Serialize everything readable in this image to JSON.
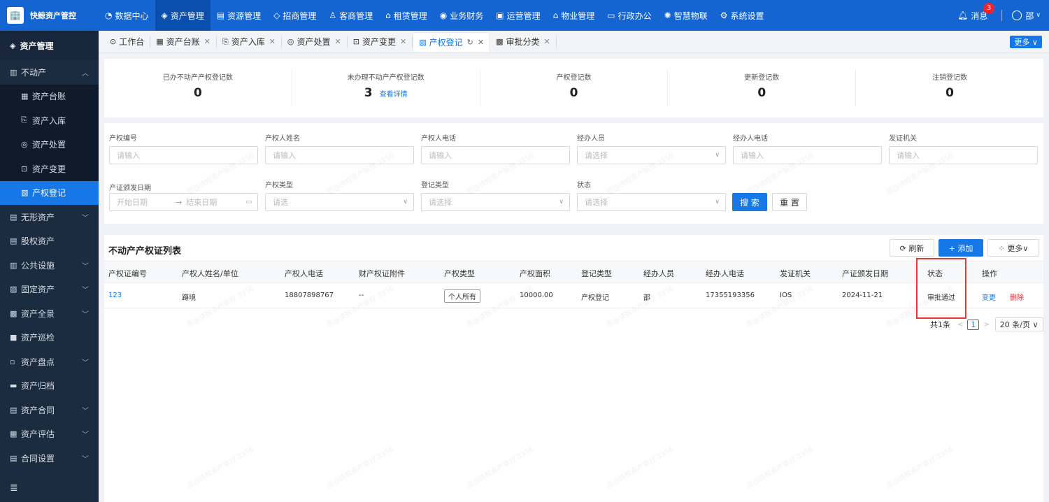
{
  "app": {
    "logo_glyph": "🏢",
    "title": "快鲸资产管控"
  },
  "nav": [
    {
      "icon": "◔",
      "label": "数据中心"
    },
    {
      "icon": "◈",
      "label": "资产管理",
      "active": true
    },
    {
      "icon": "▤",
      "label": "资源管理"
    },
    {
      "icon": "◇",
      "label": "招商管理"
    },
    {
      "icon": "♙",
      "label": "客商管理"
    },
    {
      "icon": "⌂",
      "label": "租赁管理"
    },
    {
      "icon": "◉",
      "label": "业务财务"
    },
    {
      "icon": "▣",
      "label": "运营管理"
    },
    {
      "icon": "⌂",
      "label": "物业管理"
    },
    {
      "icon": "▭",
      "label": "行政办公"
    },
    {
      "icon": "✺",
      "label": "智慧物联"
    },
    {
      "icon": "⚙",
      "label": "系统设置"
    }
  ],
  "header": {
    "messages_label": "消息",
    "badge": "3",
    "user_name": "邵"
  },
  "sidebar": {
    "title": "资产管理",
    "group": "不动产",
    "sub_items": [
      {
        "icon": "▦",
        "label": "资产台账"
      },
      {
        "icon": "⎘",
        "label": "资产入库"
      },
      {
        "icon": "◎",
        "label": "资产处置"
      },
      {
        "icon": "⊡",
        "label": "资产变更"
      },
      {
        "icon": "▧",
        "label": "产权登记",
        "active": true
      }
    ],
    "items": [
      {
        "icon": "▤",
        "label": "无形资产",
        "chev": true
      },
      {
        "icon": "▤",
        "label": "股权资产",
        "chev": false
      },
      {
        "icon": "▥",
        "label": "公共设施",
        "chev": true
      },
      {
        "icon": "▨",
        "label": "固定资产",
        "chev": true
      },
      {
        "icon": "▩",
        "label": "资产全景",
        "chev": true
      },
      {
        "icon": "■",
        "label": "资产巡检",
        "chev": false
      },
      {
        "icon": "▫",
        "label": "资产盘点",
        "chev": true
      },
      {
        "icon": "▬",
        "label": "资产归档",
        "chev": false
      },
      {
        "icon": "▤",
        "label": "资产合同",
        "chev": true
      },
      {
        "icon": "▦",
        "label": "资产评估",
        "chev": true
      },
      {
        "icon": "▤",
        "label": "合同设置",
        "chev": true
      }
    ],
    "collapse_icon": "≣"
  },
  "tabs": [
    {
      "icon": "⊙",
      "label": "工作台",
      "closable": false
    },
    {
      "icon": "▦",
      "label": "资产台账",
      "closable": true
    },
    {
      "icon": "⎘",
      "label": "资产入库",
      "closable": true
    },
    {
      "icon": "◎",
      "label": "资产处置",
      "closable": true
    },
    {
      "icon": "⊡",
      "label": "资产变更",
      "closable": true
    },
    {
      "icon": "▧",
      "label": "产权登记",
      "closable": true,
      "active": true
    },
    {
      "icon": "▩",
      "label": "审批分类",
      "closable": true
    }
  ],
  "tabs_more": "更多 ∨",
  "stats": [
    {
      "label": "已办不动产产权登记数",
      "value": "0"
    },
    {
      "label": "未办理不动产产权登记数",
      "value": "3",
      "link": "查看详情"
    },
    {
      "label": "产权登记数",
      "value": "0"
    },
    {
      "label": "更新登记数",
      "value": "0"
    },
    {
      "label": "注销登记数",
      "value": "0"
    }
  ],
  "filter": {
    "row1": [
      {
        "label": "产权编号",
        "placeholder": "请输入",
        "select": false
      },
      {
        "label": "产权人姓名",
        "placeholder": "请输入",
        "select": false
      },
      {
        "label": "产权人电话",
        "placeholder": "请输入",
        "select": false
      },
      {
        "label": "经办人员",
        "placeholder": "请选择",
        "select": true
      },
      {
        "label": "经办人电话",
        "placeholder": "请输入",
        "select": false
      },
      {
        "label": "发证机关",
        "placeholder": "请输入",
        "select": false
      }
    ],
    "date_label": "产证颁发日期",
    "date_start": "开始日期",
    "date_sep": "→",
    "date_end": "结束日期",
    "row2": [
      {
        "label": "产权类型",
        "placeholder": "请选",
        "select": true
      },
      {
        "label": "登记类型",
        "placeholder": "请选择",
        "select": true
      },
      {
        "label": "状态",
        "placeholder": "请选择",
        "select": true
      }
    ],
    "search": "搜 索",
    "reset": "重 置"
  },
  "list": {
    "title": "不动产产权证列表",
    "refresh": "⟳  刷新",
    "add": "+  添加",
    "more": "⁘  更多∨",
    "columns": [
      "产权证编号",
      "产权人姓名/单位",
      "产权人电话",
      "财产权证附件",
      "产权类型",
      "产权面积",
      "登记类型",
      "经办人员",
      "经办人电话",
      "发证机关",
      "产证颁发日期",
      "状态",
      "操作"
    ],
    "rows": [
      {
        "code": "123",
        "owner": "蹲境",
        "phone": "18807898767",
        "attach": "--",
        "type": "个人所有",
        "area": "10000.00",
        "reg_type": "产权登记",
        "handler": "邵",
        "handler_phone": "17355193356",
        "authority": "IOS",
        "date": "2024-11-21",
        "status": "审批通过",
        "op_change": "变更",
        "op_delete": "删除"
      }
    ],
    "pager": {
      "total": "共1条",
      "page": "1",
      "size": "20 条/页 ∨"
    }
  },
  "watermark": "邵@快鲸资产管控 3356",
  "colors": {
    "topbar": "#1464d2",
    "sidebar": "#1b2b40",
    "accent": "#1677e6",
    "danger": "#f5222d",
    "highlight": "#e53935"
  }
}
